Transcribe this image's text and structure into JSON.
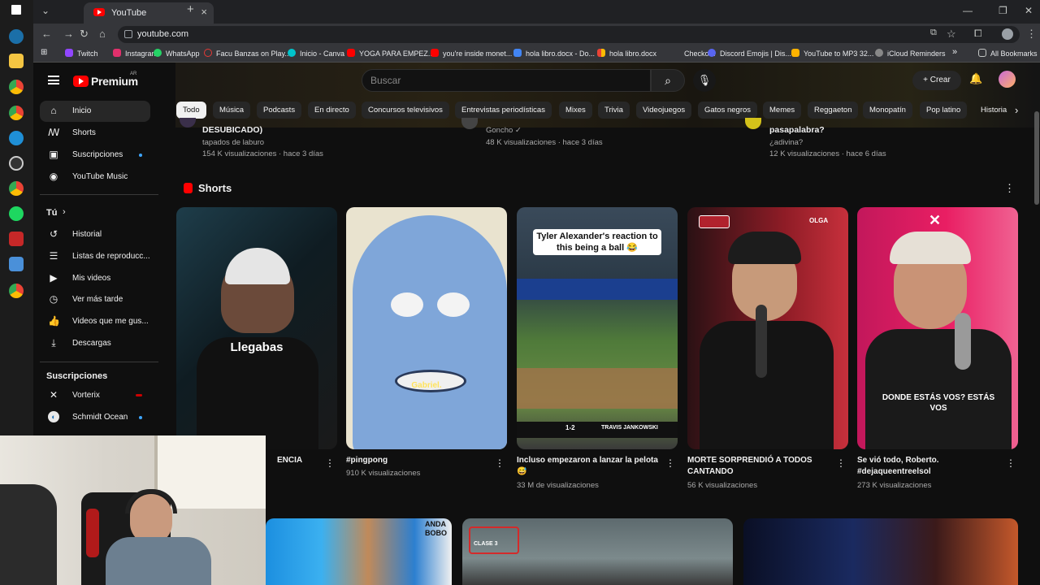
{
  "browser": {
    "tab_title": "YouTube",
    "url": "youtube.com",
    "bookmarks": [
      "Twitch",
      "Instagram",
      "WhatsApp",
      "Facu Banzas on Play...",
      "Inicio - Canva",
      "YOGA PARA EMPEZ...",
      "you're inside monet...",
      "hola libro.docx - Do...",
      "hola libro.docx",
      "Checkout",
      "Discord Emojis | Dis...",
      "YouTube to MP3 32...",
      "iCloud Reminders"
    ],
    "bookmarks_more": "»",
    "all_bookmarks": "All Bookmarks"
  },
  "youtube": {
    "logo_text": "Premium",
    "region": "AR",
    "search_placeholder": "Buscar",
    "create_label": "Crear"
  },
  "sidebar": {
    "main": [
      {
        "label": "Inicio",
        "icon": "home-icon"
      },
      {
        "label": "Shorts",
        "icon": "shorts-icon"
      },
      {
        "label": "Suscripciones",
        "icon": "subscriptions-icon"
      },
      {
        "label": "YouTube Music",
        "icon": "music-icon"
      }
    ],
    "you_header": "Tú",
    "you": [
      {
        "label": "Historial",
        "icon": "history-icon"
      },
      {
        "label": "Listas de reproducc...",
        "icon": "playlists-icon"
      },
      {
        "label": "Mis videos",
        "icon": "my-videos-icon"
      },
      {
        "label": "Ver más tarde",
        "icon": "watch-later-icon"
      },
      {
        "label": "Videos que me gus...",
        "icon": "liked-icon"
      },
      {
        "label": "Descargas",
        "icon": "downloads-icon"
      }
    ],
    "subs_header": "Suscripciones",
    "subs": [
      {
        "label": "Vorterix"
      },
      {
        "label": "Schmidt Ocean"
      }
    ]
  },
  "chips": [
    "Todo",
    "Música",
    "Podcasts",
    "En directo",
    "Concursos televisivos",
    "Entrevistas periodísticas",
    "Mixes",
    "Trivia",
    "Videojuegos",
    "Gatos negros",
    "Memes",
    "Reggaeton",
    "Monopatín",
    "Pop latino",
    "Historia"
  ],
  "prev_row": [
    {
      "title": "DESUBICADO)",
      "channel": "tapados de laburo",
      "meta": "154 K visualizaciones · hace 3 días"
    },
    {
      "title": "",
      "channel": "Goncho",
      "meta": "48 K visualizaciones · hace 3 días"
    },
    {
      "title": "pasapalabra?",
      "channel": "¿adivina?",
      "meta": "12 K visualizaciones · hace 6 días"
    }
  ],
  "shorts": {
    "header": "Shorts",
    "items": [
      {
        "title": "ENCIA",
        "views": "",
        "overlay": "Llegabas"
      },
      {
        "title": "#pingpong",
        "views": "910 K visualizaciones",
        "overlay": "Gabriel."
      },
      {
        "title": "Incluso empezaron a lanzar la pelota 😅",
        "views": "33 M de visualizaciones",
        "overlay": "Tyler Alexander's reaction to this being a ball 😂",
        "scoreboard": "TRAVIS JANKOWSKI",
        "score": "1-2"
      },
      {
        "title": "MORTE SORPRENDIÓ A TODOS CANTANDO",
        "views": "56 K visualizaciones",
        "overlay": "OLGA"
      },
      {
        "title": "Se vió todo, Roberto. #dejaqueentreelsol",
        "views": "273 K visualizaciones",
        "overlay": "DONDE ESTÁS VOS? ESTÁS VOS"
      }
    ]
  },
  "bottom_row": [
    {
      "overlay": "ANDA BOBO"
    },
    {
      "overlay": "CLASE 3"
    },
    {
      "overlay": ""
    }
  ],
  "colors": {
    "bg": "#0f0f0f",
    "accent_red": "#ff0000",
    "chip": "#272727",
    "dot_blue": "#3ea6ff"
  }
}
